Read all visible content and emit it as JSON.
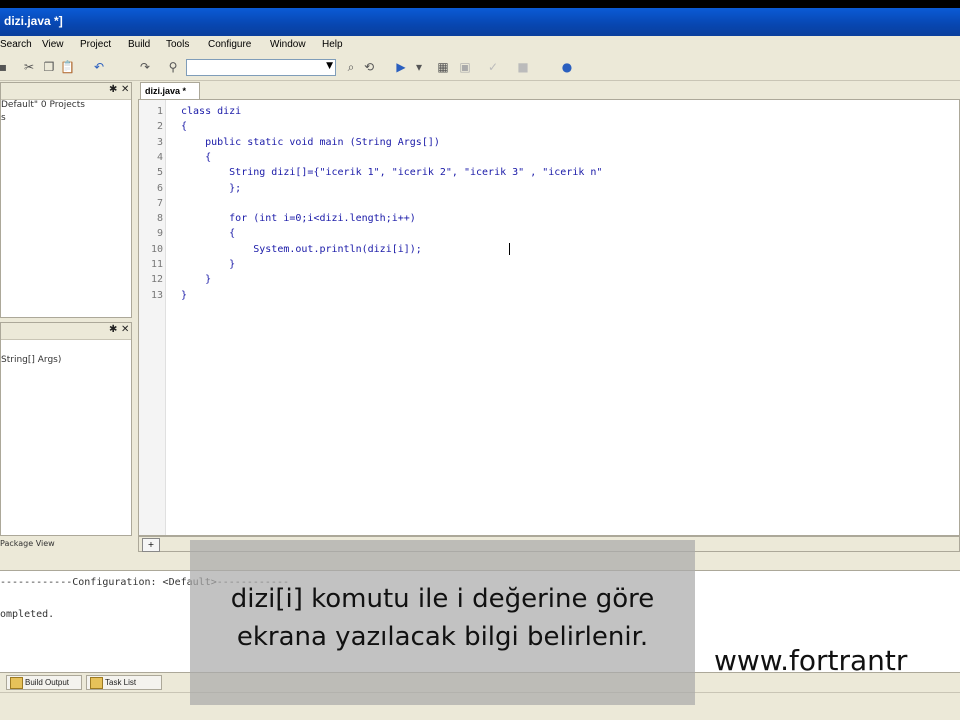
{
  "window": {
    "title": "dizi.java *]"
  },
  "menu": [
    "Search",
    "View",
    "Project",
    "Build",
    "Tools",
    "Configure",
    "Window",
    "Help"
  ],
  "left_panel_top": {
    "line1": "Default\" 0 Projects",
    "line2": "s"
  },
  "left_panel_bottom": {
    "line1": "String[] Args)"
  },
  "left_panel_tabs": {
    "package_view": "Package View"
  },
  "editor": {
    "tab_label": "dizi.java *",
    "line_numbers": [
      "1",
      "2",
      "3",
      "4",
      "5",
      "6",
      "7",
      "8",
      "9",
      "10",
      "11",
      "12",
      "13"
    ],
    "lines": [
      "class dizi",
      "{",
      "    public static void main (String Args[])",
      "    {",
      "        String dizi[]={\"icerik 1\", \"icerik 2\", \"icerik 3\" , \"icerik n\"",
      "        };",
      "",
      "        for (int i=0;i<dizi.length;i++)",
      "        {",
      "            System.out.println(dizi[i]);",
      "        }",
      "    }",
      "}"
    ]
  },
  "output": {
    "line1": "------------Configuration: <Default>------------",
    "line2": "ompleted."
  },
  "output_tabs": {
    "build_output": "Build Output",
    "task_list": "Task List"
  },
  "subtitle": {
    "line1": "dizi[i] komutu ile i değerine göre",
    "line2": "ekrana yazılacak bilgi belirlenir."
  },
  "watermark": "www.fortrantr",
  "colors": {
    "code": "#1a1aa8",
    "titlebar": "#0846b0"
  }
}
